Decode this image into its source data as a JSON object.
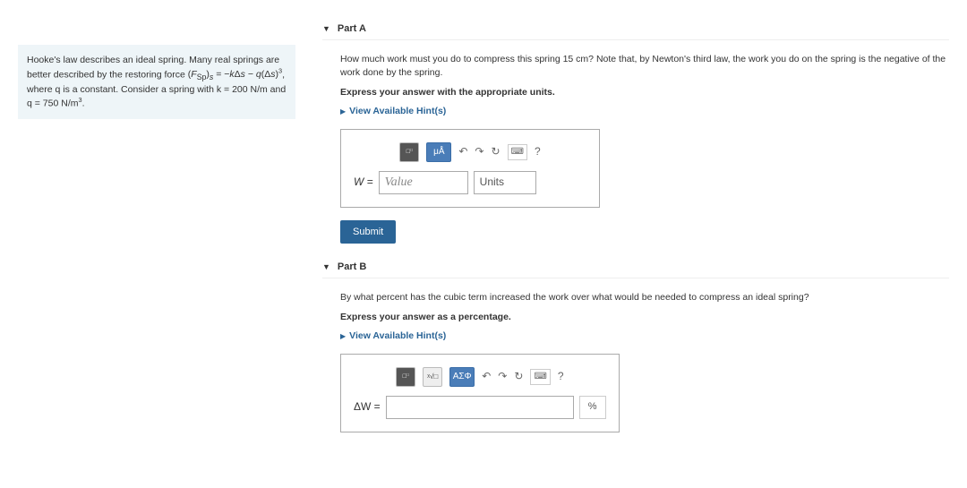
{
  "intro": {
    "line1": "Hooke's law describes an ideal spring. Many real springs are better described by the restoring force",
    "formula_prefix": "(F",
    "formula_sub": "Sp",
    "formula_suffix": ")",
    "formula_sub2": "s",
    "formula_eq": " = −kΔs − q(Δs)",
    "formula_exp": "3",
    "line2_tail": ", where q is a constant. Consider a spring with k = 200 N/m and q = 750 N/m",
    "line2_exp": "3",
    "line2_end": "."
  },
  "partA": {
    "title": "Part A",
    "question": "How much work must you do to compress this spring 15 cm? Note that, by Newton's third law, the work you do on the spring is the negative of the work done by the spring.",
    "instruction": "Express your answer with the appropriate units.",
    "hints": "View Available Hint(s)",
    "var": "W =",
    "value_placeholder": "Value",
    "units_placeholder": "Units",
    "toolbar": {
      "units": "μÅ"
    },
    "submit": "Submit"
  },
  "partB": {
    "title": "Part B",
    "question": "By what percent has the cubic term increased the work over what would be needed to compress an ideal spring?",
    "instruction": "Express your answer as a percentage.",
    "hints": "View Available Hint(s)",
    "var": "ΔW =",
    "toolbar": {
      "greek": "ΑΣΦ"
    },
    "unit": "%"
  },
  "icons": {
    "help": "?",
    "undo": "↶",
    "redo": "↷",
    "reset": "↻",
    "keyboard": "⌨"
  }
}
